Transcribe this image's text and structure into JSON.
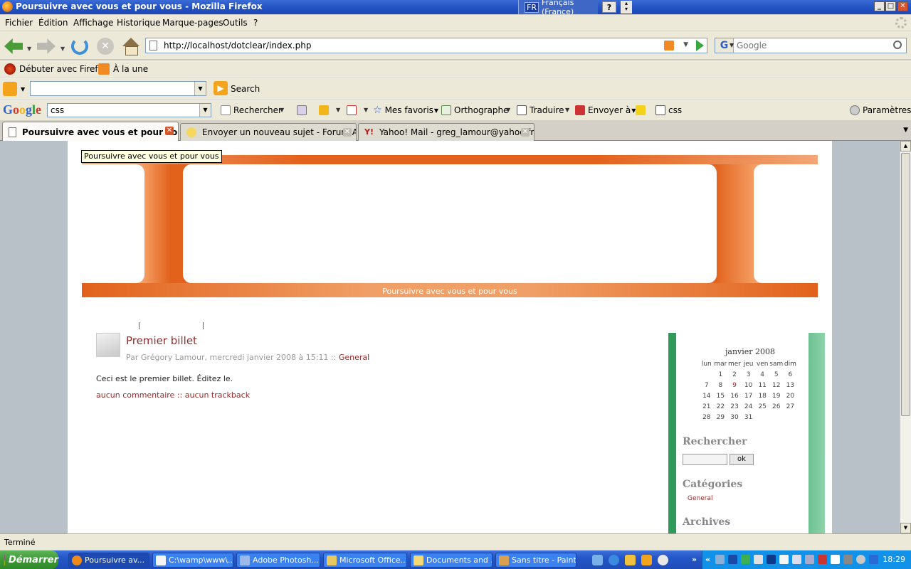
{
  "window": {
    "title": "Poursuivre avec vous et pour vous - Mozilla Firefox",
    "lang_code": "FR",
    "lang_name": "Français (France)",
    "help": "?",
    "minimize": "_",
    "maximize": "□",
    "close": "✕"
  },
  "menu": [
    "Fichier",
    "Édition",
    "Affichage",
    "Historique",
    "Marque-pages",
    "Outils",
    "?"
  ],
  "nav": {
    "url": "http://localhost/dotclear/index.php",
    "search_placeholder": "Google",
    "search_engine_letter": "G"
  },
  "bookmarks": [
    {
      "label": "Débuter avec Firefox",
      "icon": "firefox-icon"
    },
    {
      "label": "À la une",
      "icon": "feed-icon"
    }
  ],
  "search_toolbar": {
    "button_label": "Search"
  },
  "google_toolbar": {
    "logo": "Google",
    "query": "css",
    "items": [
      "Rechercher",
      "Mes favoris",
      "Orthographe",
      "Traduire",
      "Envoyer à",
      "css",
      "Paramètres"
    ]
  },
  "tabs": [
    {
      "title": "Poursuivre avec vous et pour vous",
      "active": true
    },
    {
      "title": "Envoyer un nouveau sujet - Forum Als...",
      "active": false
    },
    {
      "title": "Yahoo! Mail - greg_lamour@yahoo.fr",
      "active": false
    }
  ],
  "page": {
    "tooltip": "Poursuivre avec vous et pour vous",
    "blog_title": "Poursuivre avec vous et pour vous",
    "post": {
      "title": "Premier billet",
      "meta_prefix": "Par Grégory Lamour, mercredi janvier 2008 à 15:11 :: ",
      "category": "General",
      "body": "Ceci est le premier billet. Éditez le.",
      "comments": "aucun commentaire",
      "separator": "::",
      "trackback": "aucun trackback"
    },
    "sidebar": {
      "calendar_title": "janvier 2008",
      "weekdays": [
        "lun",
        "mar",
        "mer",
        "jeu",
        "ven",
        "sam",
        "dim"
      ],
      "weeks": [
        [
          "",
          "1",
          "2",
          "3",
          "4",
          "5",
          "6"
        ],
        [
          "7",
          "8",
          "9",
          "10",
          "11",
          "12",
          "13"
        ],
        [
          "14",
          "15",
          "16",
          "17",
          "18",
          "19",
          "20"
        ],
        [
          "21",
          "22",
          "23",
          "24",
          "25",
          "26",
          "27"
        ],
        [
          "28",
          "29",
          "30",
          "31",
          "",
          "",
          ""
        ]
      ],
      "linked_day": "9",
      "search_heading": "Rechercher",
      "search_button": "ok",
      "categories_heading": "Catégories",
      "categories": [
        "General"
      ],
      "archives_heading": "Archives"
    }
  },
  "status": "Terminé",
  "taskbar": {
    "start": "Démarrer",
    "tasks": [
      {
        "label": "Poursuivre av...",
        "active": true
      },
      {
        "label": "C:\\wamp\\www\\...",
        "active": false
      },
      {
        "label": "Adobe Photosh...",
        "active": false
      },
      {
        "label": "Microsoft Office...",
        "active": false
      },
      {
        "label": "Documents and ...",
        "active": false
      },
      {
        "label": "Sans titre - Paint",
        "active": false
      }
    ],
    "clock": "18:29"
  }
}
